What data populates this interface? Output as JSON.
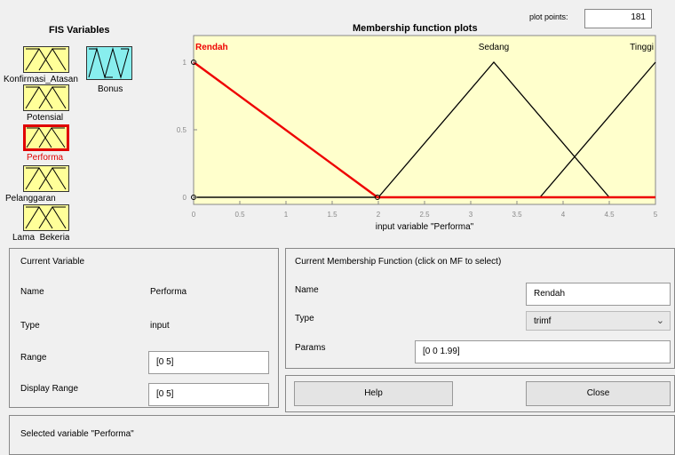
{
  "fis_panel": {
    "title": "FIS Variables",
    "variables": [
      {
        "label": "Konfirmasi_Atasan",
        "kind": "input"
      },
      {
        "label": "Bonus",
        "kind": "output"
      },
      {
        "label": "Potensial",
        "kind": "input"
      },
      {
        "label": "Performa",
        "kind": "input",
        "selected": true
      },
      {
        "label": "Pelanggaran",
        "kind": "input"
      },
      {
        "label": "Lama_Bekerja",
        "kind": "input"
      }
    ]
  },
  "plot": {
    "title": "Membership function plots",
    "plot_points_label": "plot points:",
    "plot_points_value": "181",
    "xlabel": "input variable \"Performa\"",
    "mf_labels": [
      "Rendah",
      "Sedang",
      "Tinggi"
    ]
  },
  "chart_data": {
    "type": "line",
    "xlabel": "input variable \"Performa\"",
    "x_ticks": [
      "0",
      "0.5",
      "1",
      "1.5",
      "2",
      "2.5",
      "3",
      "3.5",
      "4",
      "4.5",
      "5"
    ],
    "y_ticks": [
      "0",
      "0.5",
      "1"
    ],
    "xlim": [
      0,
      5
    ],
    "ylim": [
      0,
      1
    ],
    "background_color": "#ffffcc",
    "series": [
      {
        "name": "Rendah",
        "type": "trimf",
        "x": [
          0,
          0,
          1.99,
          5
        ],
        "y": [
          1,
          1,
          0,
          0
        ],
        "color": "#ee0000",
        "selected": true
      },
      {
        "name": "Sedang",
        "type": "trimf",
        "x": [
          0,
          2,
          3.25,
          4.5,
          5
        ],
        "y": [
          0,
          0,
          1,
          0,
          0
        ],
        "color": "#000000"
      },
      {
        "name": "Tinggi",
        "type": "trimf",
        "x": [
          0,
          3.75,
          5
        ],
        "y": [
          0,
          0,
          1
        ],
        "color": "#000000"
      }
    ]
  },
  "current_variable": {
    "heading": "Current Variable",
    "name_label": "Name",
    "name_value": "Performa",
    "type_label": "Type",
    "type_value": "input",
    "range_label": "Range",
    "range_value": "[0 5]",
    "display_range_label": "Display Range",
    "display_range_value": "[0 5]"
  },
  "current_mf": {
    "heading": "Current Membership Function (click on MF to select)",
    "name_label": "Name",
    "name_value": "Rendah",
    "type_label": "Type",
    "type_value": "trimf",
    "params_label": "Params",
    "params_value": "[0 0 1.99]"
  },
  "buttons": {
    "help": "Help",
    "close": "Close"
  },
  "status": "Selected variable \"Performa\""
}
